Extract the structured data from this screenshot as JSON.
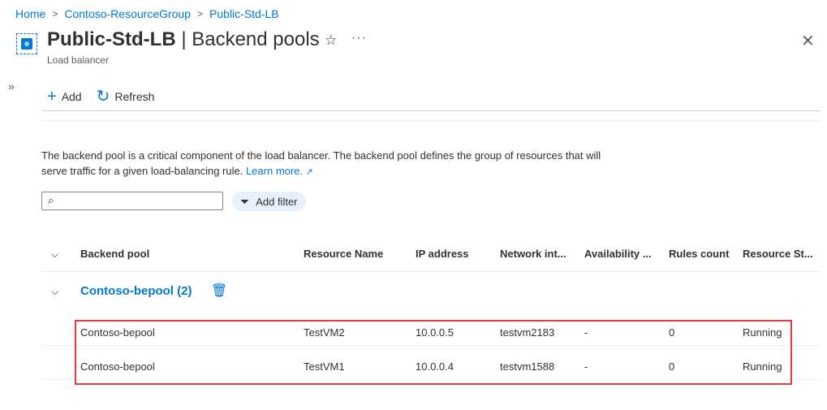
{
  "breadcrumb": [
    "Home",
    "Contoso-ResourceGroup",
    "Public-Std-LB"
  ],
  "header": {
    "title_main": "Public-Std-LB",
    "title_rest": " | Backend pools",
    "subtitle": "Load balancer"
  },
  "toolbar": {
    "add": "Add",
    "refresh": "Refresh"
  },
  "description": {
    "text": "The backend pool is a critical component of the load balancer. The backend pool defines the group of resources that will serve traffic for a given load-balancing rule. ",
    "link": "Learn more."
  },
  "search": {
    "value": ""
  },
  "filter_label": "Add filter",
  "table": {
    "columns": [
      "Backend pool",
      "Resource Name",
      "IP address",
      "Network int...",
      "Availability ...",
      "Rules count",
      "Resource St..."
    ],
    "group": "Contoso-bepool (2)",
    "rows": [
      [
        "Contoso-bepool",
        "TestVM2",
        "10.0.0.5",
        "testvm2183",
        "-",
        "0",
        "Running"
      ],
      [
        "Contoso-bepool",
        "TestVM1",
        "10.0.0.4",
        "testvm1588",
        "-",
        "0",
        "Running"
      ]
    ]
  },
  "colors": {
    "accent": "#0078d4",
    "highlight": "#e5393f"
  },
  "icons": [
    "load-balancer-icon",
    "star-icon",
    "more-icon",
    "close-icon",
    "expand-icon",
    "add-icon",
    "refresh-icon",
    "search-icon",
    "filter-icon",
    "chevron-down-icon",
    "trash-icon",
    "external-link-icon"
  ]
}
